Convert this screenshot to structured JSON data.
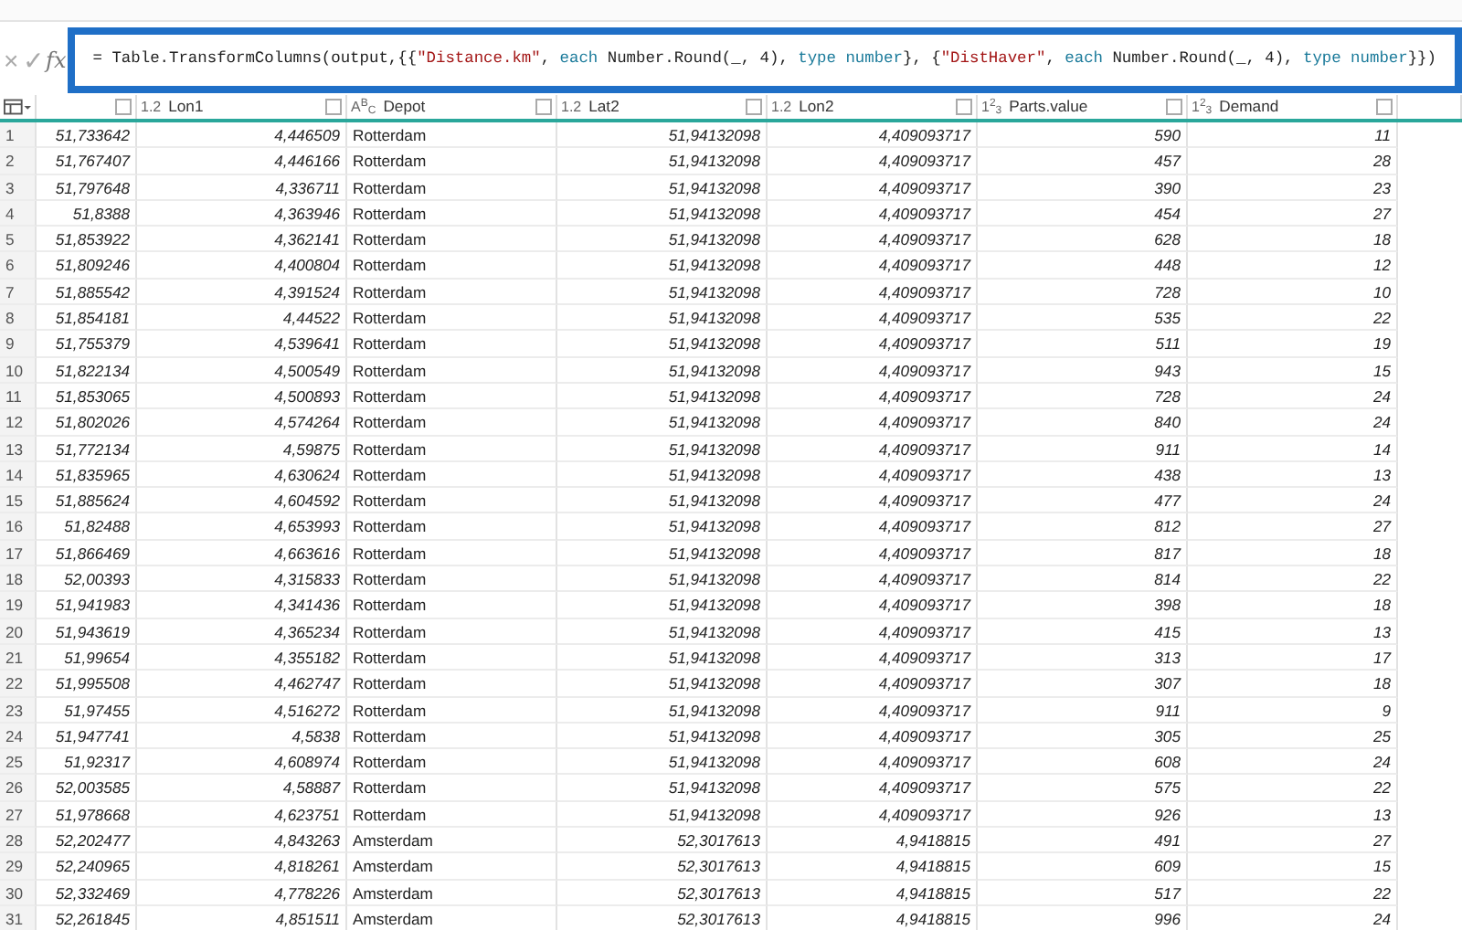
{
  "formula_bar": {
    "cancel": "×",
    "confirm": "✓",
    "fx": "fx",
    "formula": [
      {
        "kind": "plain",
        "text": "= Table.TransformColumns(output,{{"
      },
      {
        "kind": "string",
        "text": "\"Distance.km\""
      },
      {
        "kind": "plain",
        "text": ", "
      },
      {
        "kind": "keyword",
        "text": "each"
      },
      {
        "kind": "plain",
        "text": " Number.Round(_, 4), "
      },
      {
        "kind": "keyword",
        "text": "type number"
      },
      {
        "kind": "plain",
        "text": "}, {"
      },
      {
        "kind": "string",
        "text": "\"DistHaver\""
      },
      {
        "kind": "plain",
        "text": ", "
      },
      {
        "kind": "keyword",
        "text": "each"
      },
      {
        "kind": "plain",
        "text": " Number.Round(_, 4), "
      },
      {
        "kind": "keyword",
        "text": "type number"
      },
      {
        "kind": "plain",
        "text": "}})"
      }
    ],
    "highlighted": true
  },
  "table": {
    "columns": [
      {
        "kind": "number"
      },
      {
        "kind": "number",
        "type": "1.2",
        "label": "Lon1"
      },
      {
        "kind": "text",
        "type": "A$^{B}$$_{C}$",
        "label": "Depot"
      },
      {
        "kind": "number",
        "type": "1.2",
        "label": "Lat2"
      },
      {
        "kind": "number",
        "type": "1.2",
        "label": "Lon2"
      },
      {
        "kind": "number",
        "type": "1$^{2}$$_{3}$",
        "label": "Parts.value"
      },
      {
        "kind": "number",
        "type": "1$^{2}$$_{3}$",
        "label": "Demand"
      }
    ],
    "rows": [
      {
        "n": "1",
        "cells": [
          "51,733642",
          "4,446509",
          "Rotterdam",
          "51,94132098",
          "4,409093717",
          "590",
          "11"
        ]
      },
      {
        "n": "2",
        "cells": [
          "51,767407",
          "4,446166",
          "Rotterdam",
          "51,94132098",
          "4,409093717",
          "457",
          "28"
        ]
      },
      {
        "n": "3",
        "cells": [
          "51,797648",
          "4,336711",
          "Rotterdam",
          "51,94132098",
          "4,409093717",
          "390",
          "23"
        ]
      },
      {
        "n": "4",
        "cells": [
          "51,8388",
          "4,363946",
          "Rotterdam",
          "51,94132098",
          "4,409093717",
          "454",
          "27"
        ]
      },
      {
        "n": "5",
        "cells": [
          "51,853922",
          "4,362141",
          "Rotterdam",
          "51,94132098",
          "4,409093717",
          "628",
          "18"
        ]
      },
      {
        "n": "6",
        "cells": [
          "51,809246",
          "4,400804",
          "Rotterdam",
          "51,94132098",
          "4,409093717",
          "448",
          "12"
        ]
      },
      {
        "n": "7",
        "cells": [
          "51,885542",
          "4,391524",
          "Rotterdam",
          "51,94132098",
          "4,409093717",
          "728",
          "10"
        ]
      },
      {
        "n": "8",
        "cells": [
          "51,854181",
          "4,44522",
          "Rotterdam",
          "51,94132098",
          "4,409093717",
          "535",
          "22"
        ]
      },
      {
        "n": "9",
        "cells": [
          "51,755379",
          "4,539641",
          "Rotterdam",
          "51,94132098",
          "4,409093717",
          "511",
          "19"
        ]
      },
      {
        "n": "10",
        "cells": [
          "51,822134",
          "4,500549",
          "Rotterdam",
          "51,94132098",
          "4,409093717",
          "943",
          "15"
        ]
      },
      {
        "n": "11",
        "cells": [
          "51,853065",
          "4,500893",
          "Rotterdam",
          "51,94132098",
          "4,409093717",
          "728",
          "24"
        ]
      },
      {
        "n": "12",
        "cells": [
          "51,802026",
          "4,574264",
          "Rotterdam",
          "51,94132098",
          "4,409093717",
          "840",
          "24"
        ]
      },
      {
        "n": "13",
        "cells": [
          "51,772134",
          "4,59875",
          "Rotterdam",
          "51,94132098",
          "4,409093717",
          "911",
          "14"
        ]
      },
      {
        "n": "14",
        "cells": [
          "51,835965",
          "4,630624",
          "Rotterdam",
          "51,94132098",
          "4,409093717",
          "438",
          "13"
        ]
      },
      {
        "n": "15",
        "cells": [
          "51,885624",
          "4,604592",
          "Rotterdam",
          "51,94132098",
          "4,409093717",
          "477",
          "24"
        ]
      },
      {
        "n": "16",
        "cells": [
          "51,82488",
          "4,653993",
          "Rotterdam",
          "51,94132098",
          "4,409093717",
          "812",
          "27"
        ]
      },
      {
        "n": "17",
        "cells": [
          "51,866469",
          "4,663616",
          "Rotterdam",
          "51,94132098",
          "4,409093717",
          "817",
          "18"
        ]
      },
      {
        "n": "18",
        "cells": [
          "52,00393",
          "4,315833",
          "Rotterdam",
          "51,94132098",
          "4,409093717",
          "814",
          "22"
        ]
      },
      {
        "n": "19",
        "cells": [
          "51,941983",
          "4,341436",
          "Rotterdam",
          "51,94132098",
          "4,409093717",
          "398",
          "18"
        ]
      },
      {
        "n": "20",
        "cells": [
          "51,943619",
          "4,365234",
          "Rotterdam",
          "51,94132098",
          "4,409093717",
          "415",
          "13"
        ]
      },
      {
        "n": "21",
        "cells": [
          "51,99654",
          "4,355182",
          "Rotterdam",
          "51,94132098",
          "4,409093717",
          "313",
          "17"
        ]
      },
      {
        "n": "22",
        "cells": [
          "51,995508",
          "4,462747",
          "Rotterdam",
          "51,94132098",
          "4,409093717",
          "307",
          "18"
        ]
      },
      {
        "n": "23",
        "cells": [
          "51,97455",
          "4,516272",
          "Rotterdam",
          "51,94132098",
          "4,409093717",
          "911",
          "9"
        ]
      },
      {
        "n": "24",
        "cells": [
          "51,947741",
          "4,5838",
          "Rotterdam",
          "51,94132098",
          "4,409093717",
          "305",
          "25"
        ]
      },
      {
        "n": "25",
        "cells": [
          "51,92317",
          "4,608974",
          "Rotterdam",
          "51,94132098",
          "4,409093717",
          "608",
          "24"
        ]
      },
      {
        "n": "26",
        "cells": [
          "52,003585",
          "4,58887",
          "Rotterdam",
          "51,94132098",
          "4,409093717",
          "575",
          "22"
        ]
      },
      {
        "n": "27",
        "cells": [
          "51,978668",
          "4,623751",
          "Rotterdam",
          "51,94132098",
          "4,409093717",
          "926",
          "13"
        ]
      },
      {
        "n": "28",
        "cells": [
          "52,202477",
          "4,843263",
          "Amsterdam",
          "52,3017613",
          "4,9418815",
          "491",
          "27"
        ]
      },
      {
        "n": "29",
        "cells": [
          "52,240965",
          "4,818261",
          "Amsterdam",
          "52,3017613",
          "4,9418815",
          "609",
          "15"
        ]
      },
      {
        "n": "30",
        "cells": [
          "52,332469",
          "4,778226",
          "Amsterdam",
          "52,3017613",
          "4,9418815",
          "517",
          "22"
        ]
      },
      {
        "n": "31",
        "cells": [
          "52,261845",
          "4,851511",
          "Amsterdam",
          "52,3017613",
          "4,9418815",
          "996",
          "24"
        ]
      }
    ]
  }
}
